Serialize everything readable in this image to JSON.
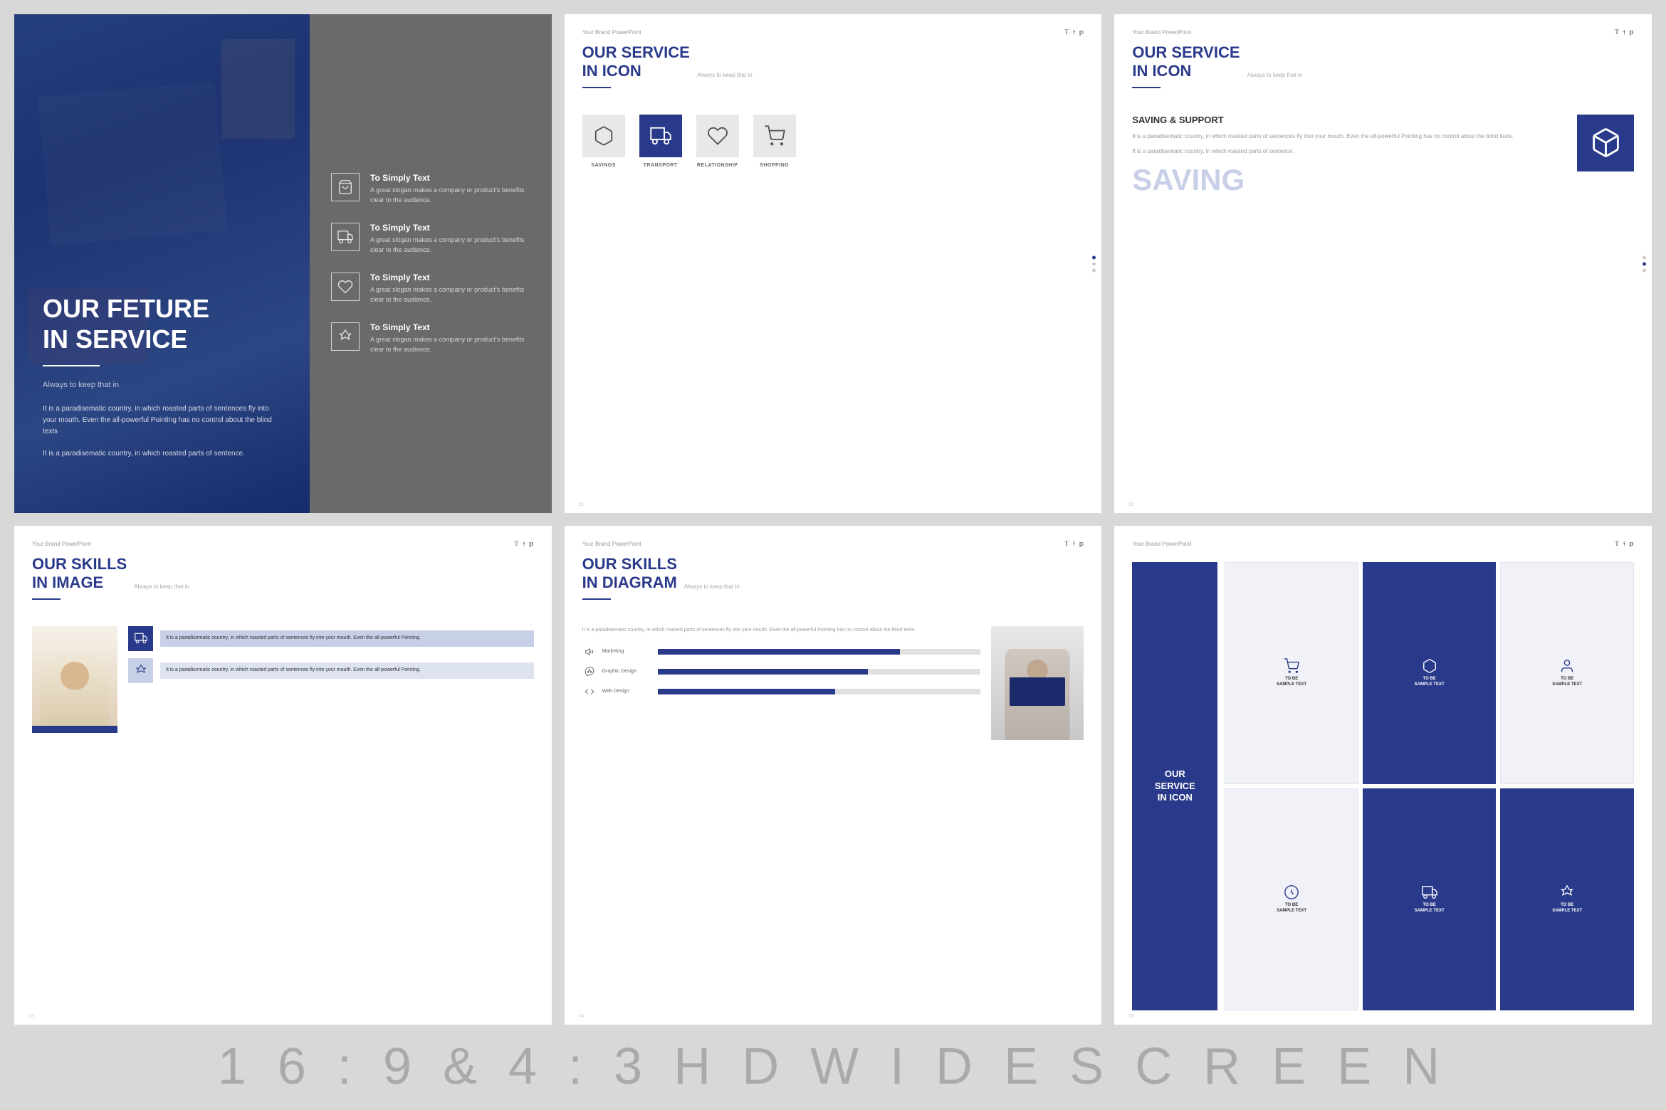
{
  "bottom_label": "1 6 : 9   &   4 : 3   H D   W I D E S C R E E N",
  "slide1": {
    "title": "OUR FETURE\nIN SERVICE",
    "subtitle": "Always to keep that in",
    "body1": "It is a paradisematic country, in which roasted parts of sentences fly into your mouth. Even the all-powerful Pointing has no control about the blind texts",
    "body2": "It is a paradisematic country, in which roasted parts of sentence.",
    "services": [
      {
        "title": "To Simply Text",
        "desc": "A great slogan makes a company or product's benefits clear to the audience."
      },
      {
        "title": "To Simply Text",
        "desc": "A great slogan makes a company or product's benefits clear to the audience."
      },
      {
        "title": "To Simply Text",
        "desc": "A great slogan makes a company or product's benefits clear to the audience."
      },
      {
        "title": "To Simply Text",
        "desc": "A great slogan makes a company or product's benefits clear to the audience."
      }
    ]
  },
  "slide2": {
    "brand": "Your Brand PowerPoint",
    "title": "OUR SERVICE\nIN ICON",
    "subtitle": "Always to keep that in",
    "icons": [
      {
        "label": "SAVINGS"
      },
      {
        "label": "TRANSPORT"
      },
      {
        "label": "RELATIONSHIP"
      },
      {
        "label": "SHOPPING"
      }
    ]
  },
  "slide3": {
    "brand": "Your Brand PowerPoint",
    "title": "OUR SERVICE\nIN ICON",
    "subtitle": "Always to keep that in",
    "saving_title": "SAVING & SUPPORT",
    "saving_body1": "It is a paradisematic country, in which roasted parts of sentences fly into your mouth. Even the all-powerful Pointing has no control about the blind texts.",
    "saving_body2": "It is a paradisematic country, in which roasted parts of sentence.",
    "saving_big": "SAVING"
  },
  "slide4": {
    "brand": "Your Brand PowerPoint",
    "title": "OUR SKILLS\nIN IMAGE",
    "subtitle": "Always to keep that in",
    "desc1": "It is a paradisematic country, in which roasted parts of sentences fly into your mouth. Even the all-powerful Pointing.",
    "desc2": "It is a paradisematic country, in which roasted parts of sentences fly into your mouth. Even the all-powerful Pointing."
  },
  "slide5": {
    "brand": "Your Brand PowerPoint",
    "title": "OUR SKILLS\nIN DIAGRAM",
    "subtitle": "Always to keep that in",
    "intro": "It is a paradisematic country, in which roasted parts of sentences fly into your mouth. Even the all-powerful Pointing has no control about the blind texts.",
    "bars": [
      {
        "label": "Marketing",
        "pct": 75
      },
      {
        "label": "Graphic Design",
        "pct": 65
      },
      {
        "label": "Web Design",
        "pct": 55
      }
    ]
  },
  "slide6": {
    "brand": "Your Brand PowerPoint",
    "title": "OUR\nSERVICE\nIN ICON",
    "boxes": [
      {
        "label": "TO BE\nSAMPLE TEXT",
        "type": "white"
      },
      {
        "label": "TO BE\nSAMPLE TEXT",
        "type": "blue"
      },
      {
        "label": "TO BE\nSAMPLE TEXT",
        "type": "white"
      },
      {
        "label": "TO BE\nSAMPLE TEXT",
        "type": "white"
      },
      {
        "label": "TO BE\nSAMPLE TEXT",
        "type": "blue"
      },
      {
        "label": "TO BE\nSAMPLE TEXT",
        "type": "blue"
      }
    ]
  }
}
